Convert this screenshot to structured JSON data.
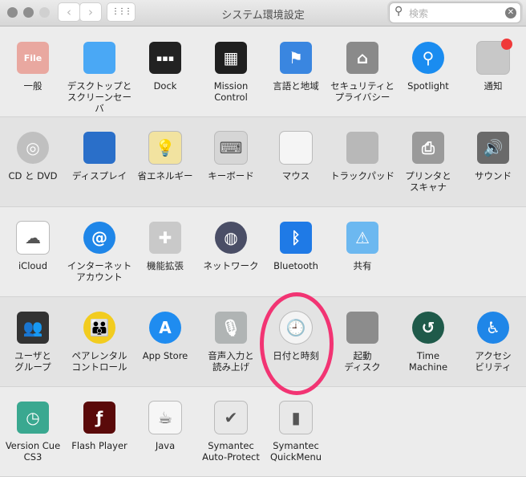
{
  "window": {
    "title": "システム環境設定",
    "back": "‹",
    "forward": "›",
    "grid": "⋮⋮⋮",
    "search_placeholder": "検索"
  },
  "rows": [
    [
      {
        "id": "general",
        "label": "一般",
        "icon": "general-icon",
        "color": "#e9a8a0",
        "glyph": "File"
      },
      {
        "id": "desktop",
        "label": "デスクトップと\nスクリーンセーバ",
        "icon": "desktop-icon",
        "color": "#4aa8f5",
        "glyph": ""
      },
      {
        "id": "dock",
        "label": "Dock",
        "icon": "dock-icon",
        "color": "#222222",
        "glyph": "▪▪▪"
      },
      {
        "id": "mission-control",
        "label": "Mission\nControl",
        "icon": "mission-control-icon",
        "color": "#1f1f1f",
        "glyph": "▦"
      },
      {
        "id": "language",
        "label": "言語と地域",
        "icon": "flag-icon",
        "color": "#3a86e0",
        "glyph": "⚑"
      },
      {
        "id": "security",
        "label": "セキュリティと\nプライバシー",
        "icon": "house-lock-icon",
        "color": "#8a8a8a",
        "glyph": "⌂"
      },
      {
        "id": "spotlight",
        "label": "Spotlight",
        "icon": "spotlight-icon",
        "color": "#1a8cf0",
        "glyph": "⚲"
      },
      {
        "id": "notifications",
        "label": "通知",
        "icon": "notifications-icon",
        "color": "#c8c8c8",
        "glyph": ""
      }
    ],
    [
      {
        "id": "cd-dvd",
        "label": "CD と DVD",
        "icon": "disc-icon",
        "color": "#c0c0c0",
        "glyph": "◎"
      },
      {
        "id": "displays",
        "label": "ディスプレイ",
        "icon": "display-icon",
        "color": "#2a6fc9",
        "glyph": ""
      },
      {
        "id": "energy",
        "label": "省エネルギー",
        "icon": "lightbulb-icon",
        "color": "#f2e3a0",
        "glyph": "💡"
      },
      {
        "id": "keyboard",
        "label": "キーボード",
        "icon": "keyboard-icon",
        "color": "#d6d6d6",
        "glyph": "⌨"
      },
      {
        "id": "mouse",
        "label": "マウス",
        "icon": "mouse-icon",
        "color": "#f5f5f5",
        "glyph": ""
      },
      {
        "id": "trackpad",
        "label": "トラックパッド",
        "icon": "trackpad-icon",
        "color": "#b8b8b8",
        "glyph": ""
      },
      {
        "id": "printers",
        "label": "プリンタと\nスキャナ",
        "icon": "printer-icon",
        "color": "#9a9a9a",
        "glyph": "⎙"
      },
      {
        "id": "sound",
        "label": "サウンド",
        "icon": "speaker-icon",
        "color": "#6a6a6a",
        "glyph": "🔊"
      }
    ],
    [
      {
        "id": "icloud",
        "label": "iCloud",
        "icon": "icloud-icon",
        "color": "#ffffff",
        "glyph": "☁"
      },
      {
        "id": "internet-accounts",
        "label": "インターネット\nアカウント",
        "icon": "at-icon",
        "color": "#1f86e8",
        "glyph": "@"
      },
      {
        "id": "extensions",
        "label": "機能拡張",
        "icon": "puzzle-icon",
        "color": "#c9c9c9",
        "glyph": "✚"
      },
      {
        "id": "network",
        "label": "ネットワーク",
        "icon": "globe-icon",
        "color": "#4a4e66",
        "glyph": "◍"
      },
      {
        "id": "bluetooth",
        "label": "Bluetooth",
        "icon": "bluetooth-icon",
        "color": "#1f7ae6",
        "glyph": "ᛒ"
      },
      {
        "id": "sharing",
        "label": "共有",
        "icon": "folder-icon",
        "color": "#6cb8f0",
        "glyph": "⚠"
      }
    ],
    [
      {
        "id": "users",
        "label": "ユーザと\nグループ",
        "icon": "users-icon",
        "color": "#333333",
        "glyph": "👥"
      },
      {
        "id": "parental",
        "label": "ペアレンタル\nコントロール",
        "icon": "parental-icon",
        "color": "#f2cc1f",
        "glyph": "👪"
      },
      {
        "id": "app-store",
        "label": "App Store",
        "icon": "app-store-icon",
        "color": "#1f8cf0",
        "glyph": "A"
      },
      {
        "id": "dictation",
        "label": "音声入力と\n読み上げ",
        "icon": "microphone-icon",
        "color": "#b0b4b4",
        "glyph": "🎙"
      },
      {
        "id": "date-time",
        "label": "日付と時刻",
        "icon": "clock-icon",
        "color": "#f4f4f4",
        "glyph": "🕘"
      },
      {
        "id": "startup-disk",
        "label": "起動\nディスク",
        "icon": "hard-disk-icon",
        "color": "#8c8c8c",
        "glyph": ""
      },
      {
        "id": "time-machine",
        "label": "Time\nMachine",
        "icon": "time-machine-icon",
        "color": "#1f5a4a",
        "glyph": "↺"
      },
      {
        "id": "accessibility",
        "label": "アクセシ\nビリティ",
        "icon": "accessibility-icon",
        "color": "#1f86e8",
        "glyph": "♿"
      }
    ],
    [
      {
        "id": "version-cue",
        "label": "Version Cue\nCS3",
        "icon": "version-cue-icon",
        "color": "#3aa890",
        "glyph": "◷"
      },
      {
        "id": "flash-player",
        "label": "Flash Player",
        "icon": "flash-icon",
        "color": "#5a0a0a",
        "glyph": "ƒ"
      },
      {
        "id": "java",
        "label": "Java",
        "icon": "java-icon",
        "color": "#f6f6f6",
        "glyph": "☕"
      },
      {
        "id": "symantec-auto-protect",
        "label": "Symantec\nAuto-Protect",
        "icon": "shield-check-icon",
        "color": "#e8e8e8",
        "glyph": "✔"
      },
      {
        "id": "symantec-quickmenu",
        "label": "Symantec\nQuickMenu",
        "icon": "quickmenu-icon",
        "color": "#e8e8e8",
        "glyph": "▮"
      }
    ]
  ],
  "highlight": {
    "target": "date-time",
    "color": "#f23473"
  }
}
